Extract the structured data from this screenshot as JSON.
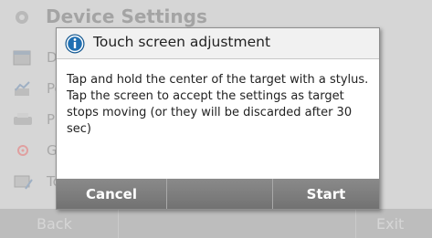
{
  "background": {
    "header": {
      "title": "Device Settings",
      "icon": "gear-icon"
    },
    "list_items": [
      {
        "label": "Da",
        "icon": "calendar-icon"
      },
      {
        "label": "Pe",
        "icon": "peripherals-icon"
      },
      {
        "label": "Pri",
        "icon": "printer-icon"
      },
      {
        "label": "GL",
        "icon": "gl-icon"
      },
      {
        "label": "Tou",
        "icon": "touch-screen-icon"
      }
    ],
    "footer": {
      "back_label": "Back",
      "exit_label": "Exit"
    }
  },
  "dialog": {
    "title": "Touch screen adjustment",
    "icon": "info-icon",
    "message": "Tap and hold the center of the target with a stylus. Tap the screen to accept the settings as target stops moving (or they will be discarded after 30 sec)",
    "buttons": {
      "cancel_label": "Cancel",
      "middle_label": "",
      "start_label": "Start"
    }
  },
  "colors": {
    "accent_blue": "#1f6fb2",
    "dialog_button_bg": "#7d7d7d",
    "background_dimmed": "#d6d6d6"
  }
}
